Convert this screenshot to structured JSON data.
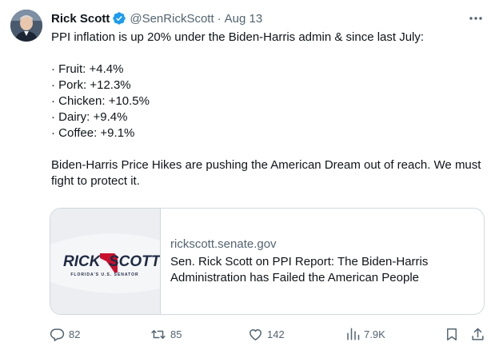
{
  "author": {
    "name": "Rick Scott",
    "handle": "@SenRickScott",
    "separator": "·",
    "date": "Aug 13",
    "avatar": "avatar"
  },
  "tweet": {
    "intro": "PPI inflation is up 20% under the Biden-Harris admin & since last July:",
    "items": [
      "· Fruit: +4.4%",
      "· Pork: +12.3%",
      "· Chicken: +10.5%",
      "· Dairy: +9.4%",
      "· Coffee: +9.1%"
    ],
    "closing": "Biden-Harris Price Hikes are pushing the American Dream out of reach. We must fight to protect it."
  },
  "card": {
    "domain": "rickscott.senate.gov",
    "title": "Sen. Rick Scott on PPI Report: The Biden-Harris Administration has Failed the American People",
    "logo_text_left": "RICK",
    "logo_text_right": "SCOTT",
    "logo_subtext": "FLORIDA'S U.S. SENATOR"
  },
  "actions": {
    "replies": "82",
    "reposts": "85",
    "likes": "142",
    "views": "7.9K"
  },
  "colors": {
    "text": "#0f1419",
    "secondary": "#536471",
    "verified": "#1d9bf0",
    "border": "#cfd9de",
    "logo_red": "#c8102e",
    "logo_navy": "#1f2a44"
  },
  "icons": [
    "verified-badge-icon",
    "more-icon",
    "reply-icon",
    "repost-icon",
    "like-icon",
    "views-icon",
    "bookmark-icon",
    "share-icon"
  ]
}
